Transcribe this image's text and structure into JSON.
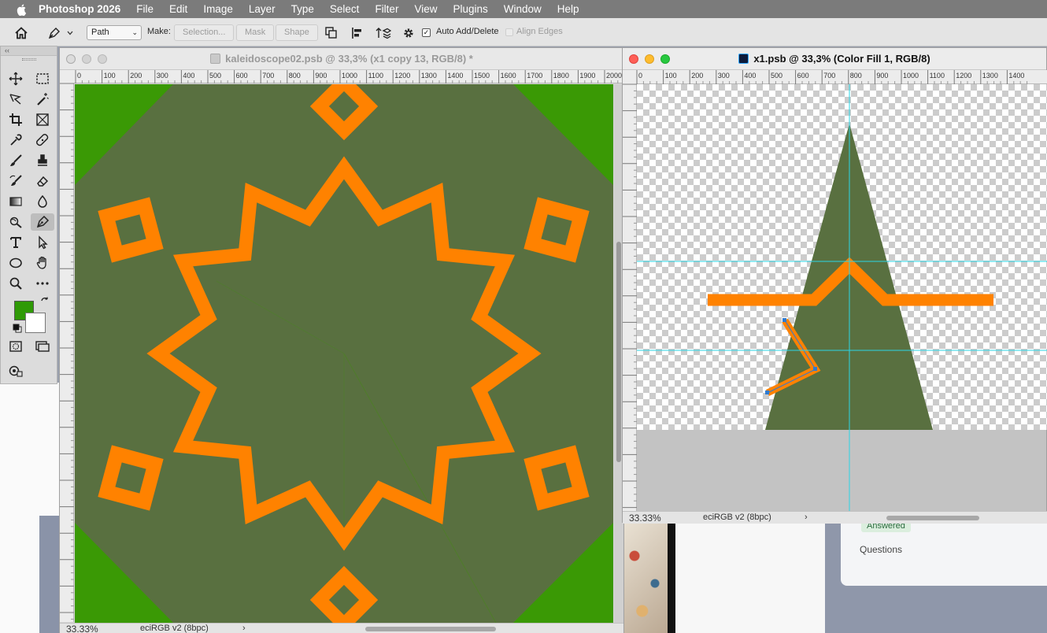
{
  "menubar": {
    "app_name": "Photoshop 2026",
    "items": [
      "File",
      "Edit",
      "Image",
      "Layer",
      "Type",
      "Select",
      "Filter",
      "View",
      "Plugins",
      "Window",
      "Help"
    ]
  },
  "options": {
    "mode_value": "Path",
    "make_label": "Make:",
    "selection_label": "Selection...",
    "mask_label": "Mask",
    "shape_label": "Shape",
    "auto_add_delete_label": "Auto Add/Delete",
    "auto_add_delete_checked": true,
    "align_edges_label": "Align Edges"
  },
  "tools_panel": {
    "collapse_glyph": "‹‹",
    "fg_color": "#2f9a06",
    "bg_color": "#ffffff",
    "tools": [
      "move-tool",
      "marquee-tool",
      "lasso-tool",
      "magic-wand-tool",
      "crop-tool",
      "frame-tool",
      "eyedropper-tool",
      "healing-tool",
      "brush-tool",
      "stamp-tool",
      "history-brush-tool",
      "eraser-tool",
      "gradient-tool",
      "blur-tool",
      "dodge-tool",
      "pen-tool",
      "type-tool",
      "path-selection-tool",
      "ellipse-tool",
      "hand-tool",
      "zoom-tool",
      "more-tools",
      "quick-mask",
      "screen-mode",
      "edit-toolbar"
    ]
  },
  "doc1": {
    "title": "kaleidoscope02.psb @ 33,3% (x1 copy 13, RGB/8) *",
    "zoom": "33.33%",
    "profile": "eciRGB v2 (8bpc)",
    "status_arrow": "›",
    "ruler_labels": [
      "0",
      "100",
      "200",
      "300",
      "400",
      "500",
      "600",
      "700",
      "800",
      "900",
      "1000",
      "1100",
      "1200",
      "1300",
      "1400",
      "1500",
      "1600",
      "1700",
      "1800",
      "1900",
      "2000"
    ],
    "colors": {
      "bg": "#597040",
      "corner": "#3a9905",
      "orange": "#ff8200"
    }
  },
  "doc2": {
    "title": "x1.psb @ 33,3% (Color Fill 1, RGB/8)",
    "zoom": "33.33%",
    "profile": "eciRGB v2 (8bpc)",
    "status_arrow": "›",
    "ruler_labels": [
      "0",
      "100",
      "200",
      "300",
      "400",
      "500",
      "600",
      "700",
      "800",
      "900",
      "1000",
      "1100",
      "1200",
      "1300",
      "1400"
    ],
    "colors": {
      "triangle": "#597040",
      "orange": "#ff8200",
      "guide": "#2bd6e6"
    }
  },
  "background": {
    "answered": "Answered",
    "questions": "Questions"
  }
}
